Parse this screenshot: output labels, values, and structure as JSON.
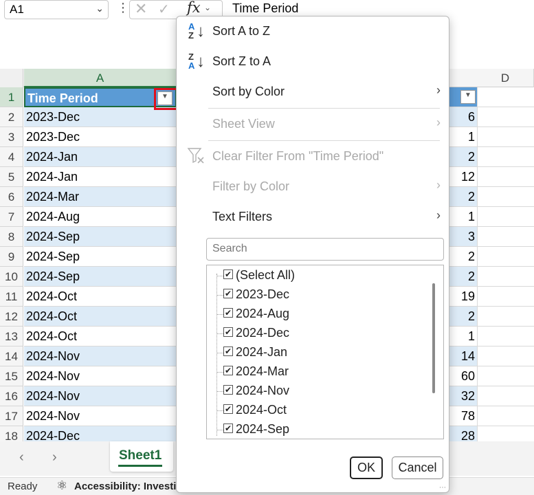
{
  "formula_bar": {
    "name_box": "A1",
    "formula": "Time Period"
  },
  "columns": {
    "a": "A",
    "d": "D"
  },
  "rows": [
    {
      "num": "1",
      "a": "Time Period",
      "c": ""
    },
    {
      "num": "2",
      "a": "2023-Dec",
      "c": "6"
    },
    {
      "num": "3",
      "a": "2023-Dec",
      "c": "1"
    },
    {
      "num": "4",
      "a": "2024-Jan",
      "c": "2"
    },
    {
      "num": "5",
      "a": "2024-Jan",
      "c": "12"
    },
    {
      "num": "6",
      "a": "2024-Mar",
      "c": "2"
    },
    {
      "num": "7",
      "a": "2024-Aug",
      "c": "1"
    },
    {
      "num": "8",
      "a": "2024-Sep",
      "c": "3"
    },
    {
      "num": "9",
      "a": "2024-Sep",
      "c": "2"
    },
    {
      "num": "10",
      "a": "2024-Sep",
      "c": "2"
    },
    {
      "num": "11",
      "a": "2024-Oct",
      "c": "19"
    },
    {
      "num": "12",
      "a": "2024-Oct",
      "c": "2"
    },
    {
      "num": "13",
      "a": "2024-Oct",
      "c": "1"
    },
    {
      "num": "14",
      "a": "2024-Nov",
      "c": "14"
    },
    {
      "num": "15",
      "a": "2024-Nov",
      "c": "60"
    },
    {
      "num": "16",
      "a": "2024-Nov",
      "c": "32"
    },
    {
      "num": "17",
      "a": "2024-Nov",
      "c": "78"
    },
    {
      "num": "18",
      "a": "2024-Dec",
      "c": "28"
    }
  ],
  "sheet_tabs": {
    "active": "Sheet1"
  },
  "status_bar": {
    "ready": "Ready",
    "accessibility": "Accessibility: Investigate"
  },
  "filter_menu": {
    "sort_az": "Sort A to Z",
    "sort_za": "Sort Z to A",
    "sort_by_color": "Sort by Color",
    "sheet_view": "Sheet View",
    "clear_filter": "Clear Filter From \"Time Period\"",
    "filter_by_color": "Filter by Color",
    "text_filters": "Text Filters",
    "search_placeholder": "Search",
    "values": [
      {
        "label": "(Select All)",
        "checked": true
      },
      {
        "label": "2023-Dec",
        "checked": true
      },
      {
        "label": "2024-Aug",
        "checked": true
      },
      {
        "label": "2024-Dec",
        "checked": true
      },
      {
        "label": "2024-Jan",
        "checked": true
      },
      {
        "label": "2024-Mar",
        "checked": true
      },
      {
        "label": "2024-Nov",
        "checked": true
      },
      {
        "label": "2024-Oct",
        "checked": true
      },
      {
        "label": "2024-Sep",
        "checked": true
      }
    ],
    "ok": "OK",
    "cancel": "Cancel"
  },
  "colors": {
    "header_fill": "#5b9bd5",
    "band_fill": "#ddebf7",
    "excel_green": "#1e6b3b",
    "highlight_red": "#e0101e"
  }
}
